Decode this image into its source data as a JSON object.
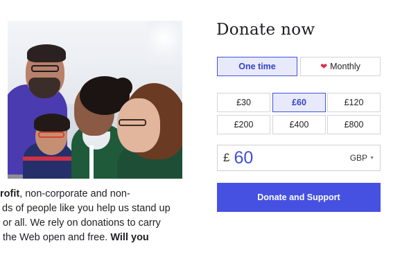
{
  "panel": {
    "title": "Donate now",
    "frequency": [
      {
        "label": "One time",
        "selected": true
      },
      {
        "label": "Monthly",
        "selected": false,
        "icon": "heart-icon"
      }
    ],
    "amounts": [
      {
        "label": "£30",
        "selected": false
      },
      {
        "label": "£60",
        "selected": true
      },
      {
        "label": "£120",
        "selected": false
      },
      {
        "label": "£200",
        "selected": false
      },
      {
        "label": "£400",
        "selected": false
      },
      {
        "label": "£800",
        "selected": false
      }
    ],
    "custom_amount": {
      "symbol": "£",
      "value": "60",
      "currency": "GBP"
    },
    "submit_label": "Donate and Support"
  },
  "blurb": {
    "line1_bold": "rofit",
    "line1_rest": ", non-corporate and non-",
    "line2": "ds of people like you help us stand up",
    "line3": "or all. We rely on donations to carry",
    "line4_rest": "the Web open and free. ",
    "line4_bold": "Will you"
  },
  "colors": {
    "accent": "#4651e2",
    "selected_bg": "#e8eafb",
    "heart": "#d8334f"
  }
}
